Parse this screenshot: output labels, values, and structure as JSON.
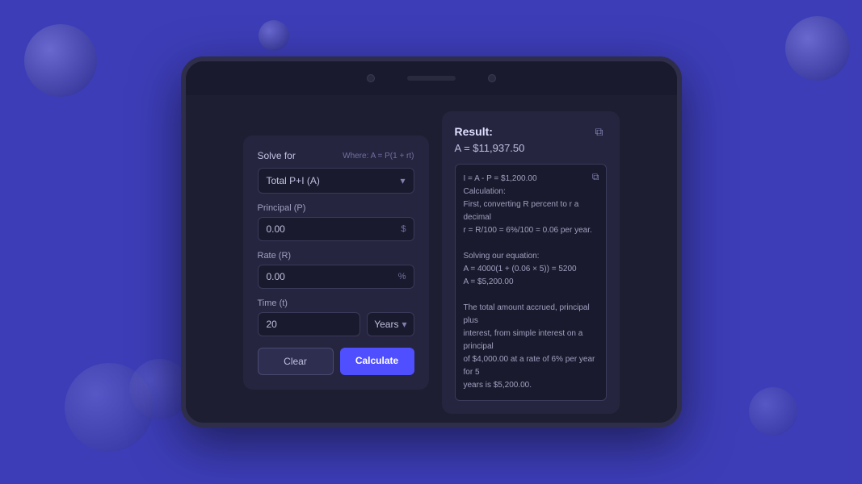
{
  "background": {
    "color": "#3d3db8"
  },
  "calc": {
    "solve_for_label": "Solve for",
    "where_formula": "Where: A = P(1 + rt)",
    "solve_for_value": "Total P+I (A)",
    "principal_label": "Principal (P)",
    "principal_value": "0.00",
    "principal_suffix": "$",
    "rate_label": "Rate (R)",
    "rate_value": "0.00",
    "rate_suffix": "%",
    "time_label": "Time (t)",
    "time_value": "20",
    "time_unit": "Years",
    "clear_label": "Clear",
    "calculate_label": "Calculate"
  },
  "result": {
    "title": "Result:",
    "main_value": "A = $11,937.50",
    "detail_line1": "I = A - P = $1,200.00",
    "detail_line2": "Calculation:",
    "detail_line3": "First, converting R percent to r a decimal",
    "detail_line4": "r = R/100 = 6%/100 = 0.06 per year.",
    "detail_line5": "",
    "detail_line6": "Solving our equation:",
    "detail_line7": "A = 4000(1 + (0.06 × 5)) = 5200",
    "detail_line8": "A = $5,200.00",
    "detail_line9": "",
    "detail_line10": "The total amount accrued, principal plus",
    "detail_line11": "interest, from simple interest on a principal",
    "detail_line12": "of $4,000.00 at a rate of 6% per year for 5",
    "detail_line13": "years is $5,200.00."
  }
}
